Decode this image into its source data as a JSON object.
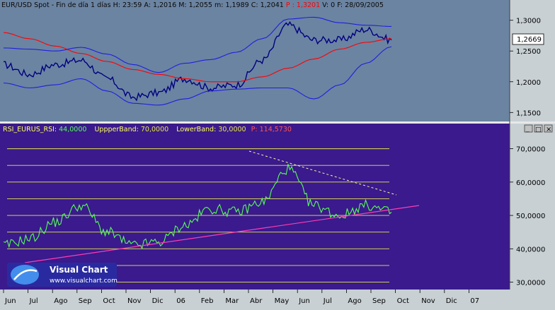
{
  "price_panel": {
    "symbol": "EUR/USD Spot",
    "timeframe": "Fin de día 1 días",
    "h_label": "H:",
    "h_value": "23:59",
    "a_label": "A:",
    "a_value": "1,2016",
    "m_label": "M:",
    "m_value": "1,2055",
    "m2_label": "m:",
    "m2_value": "1,1989",
    "c_label": "C:",
    "c_value": "1,2041",
    "p_label": "P :",
    "p_value": "1,3201",
    "v_label": "V: 0",
    "f_label": "F: 28/09/2005",
    "y_ticks": [
      "1,3000",
      "1,2500",
      "1,2000",
      "1,1500"
    ],
    "last_price": "1,2669",
    "colors": {
      "bg": "#6b84a2",
      "header": "#0a0a0a",
      "bollinger": "#1f1fe0",
      "ma": "#ff0000",
      "price": "#000080"
    }
  },
  "rsi_panel": {
    "title": "RSI_EURUS_RSI:",
    "rsi_value": "44,0000",
    "upper_label": "UppperBand:",
    "upper_value": "70,0000",
    "lower_label": "LowerBand:",
    "lower_value": "30,0000",
    "p_label": "P:",
    "p_value": "114,5730",
    "y_ticks": [
      "70,0000",
      "60,0000",
      "50,0000",
      "40,0000",
      "30,0000"
    ],
    "colors": {
      "bg": "#3a1a8c",
      "rsi": "#55ff55",
      "levels": "#e6e64a",
      "trend_up": "#ff3db4",
      "trend_down": "#f5f5a0"
    }
  },
  "x_axis": {
    "labels": [
      "Jun",
      "Jul",
      "Ago",
      "Sep",
      "Oct",
      "Nov",
      "Dic",
      "06",
      "Feb",
      "Mar",
      "Abr",
      "May",
      "Jun",
      "Jul",
      "Ago",
      "Sep",
      "Oct",
      "Nov",
      "Dic",
      "07"
    ]
  },
  "logo": {
    "name": "Visual Chart",
    "url": "www.visualchart.com"
  },
  "window_buttons": {
    "min": "_",
    "max": "□",
    "close": "×"
  },
  "chart_data": [
    {
      "type": "line",
      "title": "EUR/USD Spot - Fin de día 1 días",
      "x": [
        "Jun",
        "Jul",
        "Ago",
        "Sep",
        "Oct",
        "Nov",
        "Dic",
        "06",
        "Feb",
        "Mar",
        "Abr",
        "May",
        "Jun",
        "Jul",
        "Ago",
        "Sep"
      ],
      "ylim": [
        1.14,
        1.31
      ],
      "series": [
        {
          "name": "EUR/USD",
          "values": [
            1.228,
            1.212,
            1.228,
            1.235,
            1.205,
            1.175,
            1.182,
            1.205,
            1.19,
            1.195,
            1.235,
            1.292,
            1.268,
            1.268,
            1.285,
            1.268
          ]
        },
        {
          "name": "MA",
          "values": [
            1.28,
            1.27,
            1.258,
            1.246,
            1.233,
            1.22,
            1.212,
            1.205,
            1.2,
            1.2,
            1.208,
            1.222,
            1.237,
            1.253,
            1.264,
            1.27
          ]
        },
        {
          "name": "Bollinger Upper",
          "values": [
            1.255,
            1.253,
            1.25,
            1.256,
            1.245,
            1.228,
            1.215,
            1.23,
            1.236,
            1.248,
            1.27,
            1.302,
            1.305,
            1.296,
            1.292,
            1.29
          ]
        },
        {
          "name": "Bollinger Lower",
          "values": [
            1.198,
            1.19,
            1.195,
            1.205,
            1.185,
            1.165,
            1.162,
            1.172,
            1.185,
            1.188,
            1.19,
            1.19,
            1.172,
            1.195,
            1.23,
            1.257
          ]
        }
      ]
    },
    {
      "type": "line",
      "title": "RSI_EURUS_RSI",
      "x": [
        "Jun",
        "Jul",
        "Ago",
        "Sep",
        "Oct",
        "Nov",
        "Dic",
        "06",
        "Feb",
        "Mar",
        "Abr",
        "May",
        "Jun",
        "Jul",
        "Ago",
        "Sep"
      ],
      "ylim": [
        28,
        75
      ],
      "levels": [
        70,
        65,
        60,
        55,
        50,
        45,
        40,
        35,
        30
      ],
      "series": [
        {
          "name": "RSI",
          "values": [
            41,
            43,
            48,
            53,
            45,
            41,
            42,
            47,
            52,
            51,
            54,
            64,
            53,
            50,
            53,
            51
          ]
        }
      ]
    }
  ]
}
